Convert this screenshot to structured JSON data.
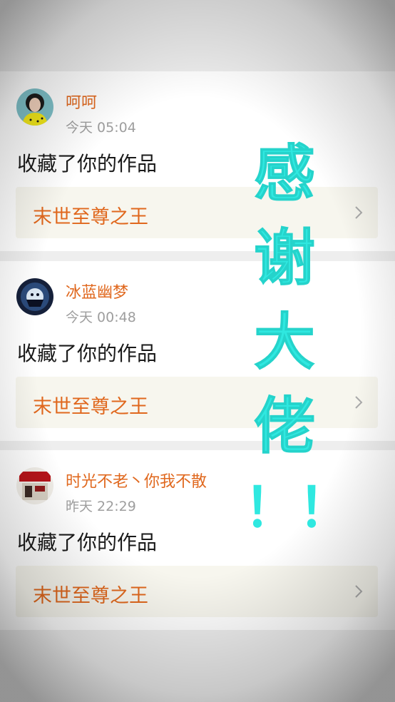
{
  "notifications": [
    {
      "user_name": "呵呵",
      "time": "今天 05:04",
      "action": "收藏了你的作品",
      "work_title": "末世至尊之王"
    },
    {
      "user_name": "冰蓝幽梦",
      "time": "今天 00:48",
      "action": "收藏了你的作品",
      "work_title": "末世至尊之王"
    },
    {
      "user_name": "时光不老丶你我不散",
      "time": "昨天 22:29",
      "action": "收藏了你的作品",
      "work_title": "末世至尊之王"
    }
  ],
  "overlay": {
    "line1": "感",
    "line2": "谢",
    "line3": "大",
    "line4": "佬",
    "exclamation": "！！"
  },
  "colors": {
    "accent_orange": "#e0681e",
    "timestamp_gray": "#9e9e9e",
    "handwriting_cyan": "#2fe8e0",
    "work_box_bg": "#f7f6ee"
  },
  "icons": {
    "chevron": "chevron-right-icon"
  }
}
